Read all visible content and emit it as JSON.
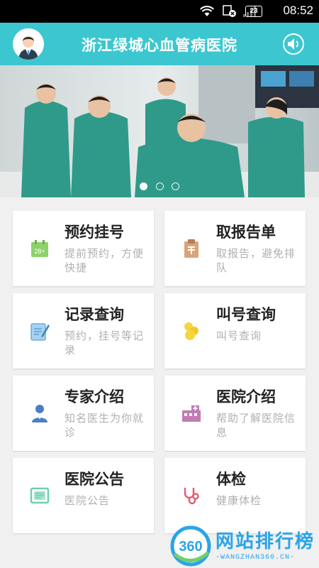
{
  "status_bar": {
    "time": "08:52",
    "battery": "23",
    "icons": [
      "wifi-icon",
      "screen-record-icon",
      "signal-icon"
    ]
  },
  "app_bar": {
    "title": "浙江绿城心血管病医院",
    "avatar_icon": "doctor-avatar-icon",
    "speaker_icon": "speaker-icon",
    "accent_color": "#3cc7d0"
  },
  "banner": {
    "image": "photo of hospital medical staff in green scrubs",
    "dots_count": 3,
    "active_dot": 0
  },
  "cards": [
    {
      "title": "预约挂号",
      "subtitle": "提前预约，方便快捷",
      "icon": "calendar-icon",
      "color": "#8dd16a"
    },
    {
      "title": "取报告单",
      "subtitle": "取报告，避免排队",
      "icon": "report-clipboard-icon",
      "color": "#d9a47a"
    },
    {
      "title": "记录查询",
      "subtitle": "预约，挂号等记录",
      "icon": "edit-document-icon",
      "color": "#6aaee0"
    },
    {
      "title": "叫号查询",
      "subtitle": "叫号查询",
      "icon": "queue-people-icon",
      "color": "#f5d63c"
    },
    {
      "title": "专家介绍",
      "subtitle": "知名医生为你就诊",
      "icon": "doctor-icon",
      "color": "#4a7fc6"
    },
    {
      "title": "医院介绍",
      "subtitle": "帮助了解医院信息",
      "icon": "hospital-building-icon",
      "color": "#c17bb5"
    },
    {
      "title": "医院公告",
      "subtitle": "医院公告",
      "icon": "notice-board-icon",
      "color": "#6fcfb0"
    },
    {
      "title": "体检",
      "subtitle": "健康体检",
      "icon": "stethoscope-icon",
      "color": "#e0607a"
    }
  ],
  "watermark": {
    "badge": "360",
    "text": "网站排行榜",
    "url": "-WANGZHAN360.CN-"
  }
}
